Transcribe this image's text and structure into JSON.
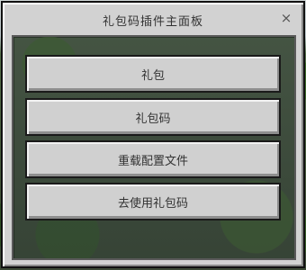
{
  "panel": {
    "title": "礼包码插件主面板",
    "close_icon": "×"
  },
  "buttons": [
    {
      "label": "礼包"
    },
    {
      "label": "礼包码"
    },
    {
      "label": "重载配置文件"
    },
    {
      "label": "去使用礼包码"
    }
  ]
}
